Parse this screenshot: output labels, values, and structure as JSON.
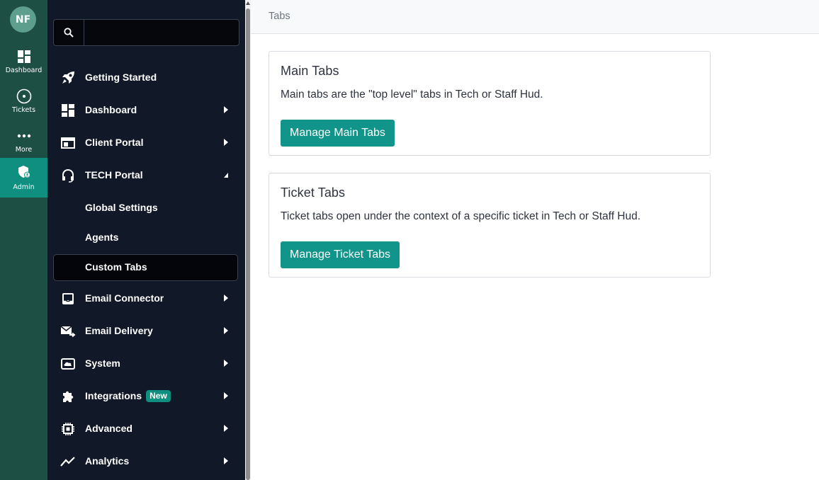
{
  "user": {
    "initials": "NF"
  },
  "rail": {
    "items": [
      {
        "label": "Dashboard",
        "icon": "dashboard-icon"
      },
      {
        "label": "Tickets",
        "icon": "tickets-icon"
      },
      {
        "label": "More",
        "icon": "more-icon"
      },
      {
        "label": "Admin",
        "icon": "admin-shield-icon",
        "active": true
      }
    ]
  },
  "search": {
    "placeholder": "",
    "value": ""
  },
  "nav": {
    "items": [
      {
        "label": "Getting Started",
        "icon": "rocket-icon"
      },
      {
        "label": "Dashboard",
        "icon": "dashboard-icon"
      },
      {
        "label": "Client Portal",
        "icon": "browser-window-icon"
      },
      {
        "label": "TECH Portal",
        "icon": "headset-icon",
        "expanded": true
      },
      {
        "label": "Global Settings"
      },
      {
        "label": "Agents"
      },
      {
        "label": "Custom Tabs",
        "selected": true
      },
      {
        "label": "Email Connector",
        "icon": "inbox-icon"
      },
      {
        "label": "Email Delivery",
        "icon": "email-send-icon"
      },
      {
        "label": "System",
        "icon": "cloud-monitor-icon"
      },
      {
        "label": "Integrations",
        "icon": "puzzle-icon",
        "badge": "New"
      },
      {
        "label": "Advanced",
        "icon": "chip-icon"
      },
      {
        "label": "Analytics",
        "icon": "trend-line-icon"
      }
    ]
  },
  "page": {
    "title": "Tabs"
  },
  "cards": [
    {
      "title": "Main Tabs",
      "description": "Main tabs are the \"top level\" tabs in Tech or Staff Hud.",
      "button": "Manage Main Tabs"
    },
    {
      "title": "Ticket Tabs",
      "description": "Ticket tabs open under the context of a specific ticket in Tech or Staff Hud.",
      "button": "Manage Ticket Tabs"
    }
  ],
  "colors": {
    "rail": "#1d4f45",
    "accent": "#11958a",
    "sidebar": "#111827"
  }
}
